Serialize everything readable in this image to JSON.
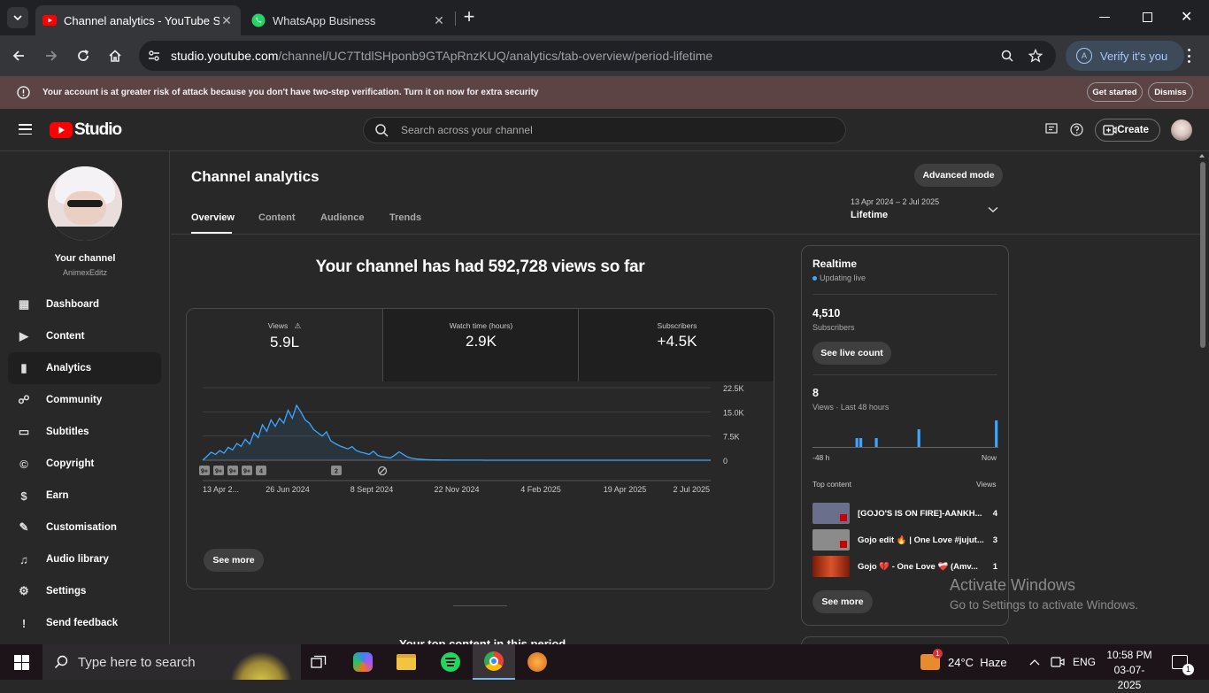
{
  "browser": {
    "tabs": [
      {
        "title": "Channel analytics - YouTube Studio",
        "active": true
      },
      {
        "title": "WhatsApp Business",
        "active": false
      }
    ],
    "url_host": "studio.youtube.com",
    "url_path": "/channel/UC7TtdlSHponb9GTApRnzKUQ/analytics/tab-overview/period-lifetime",
    "verify_label": "Verify it's you",
    "verify_avatar": "A"
  },
  "warning": {
    "text": "Your account is at greater risk of attack because you don't have two-step verification. Turn it on now for extra security",
    "get_started": "Get started",
    "dismiss": "Dismiss"
  },
  "header": {
    "logo": "Studio",
    "search_placeholder": "Search across your channel",
    "create_label": "Create"
  },
  "sidebar": {
    "channel_label": "Your channel",
    "channel_name": "AnimexEditz",
    "items": [
      {
        "label": "Dashboard",
        "icon": "dashboard-icon"
      },
      {
        "label": "Content",
        "icon": "content-icon"
      },
      {
        "label": "Analytics",
        "icon": "analytics-icon",
        "active": true
      },
      {
        "label": "Community",
        "icon": "community-icon"
      },
      {
        "label": "Subtitles",
        "icon": "subtitles-icon"
      },
      {
        "label": "Copyright",
        "icon": "copyright-icon"
      },
      {
        "label": "Earn",
        "icon": "earn-icon"
      },
      {
        "label": "Customisation",
        "icon": "customisation-icon"
      },
      {
        "label": "Audio library",
        "icon": "audio-library-icon"
      },
      {
        "label": "Settings",
        "icon": "settings-icon"
      },
      {
        "label": "Send feedback",
        "icon": "feedback-icon"
      }
    ]
  },
  "main": {
    "title": "Channel analytics",
    "advanced_mode": "Advanced mode",
    "tabs": [
      "Overview",
      "Content",
      "Audience",
      "Trends"
    ],
    "period_range": "13 Apr 2024 – 2 Jul 2025",
    "period_label": "Lifetime",
    "headline": "Your channel has had 592,728 views so far",
    "metrics": [
      {
        "label": "Views",
        "value": "5.9L",
        "warning": true
      },
      {
        "label": "Watch time (hours)",
        "value": "2.9K"
      },
      {
        "label": "Subscribers",
        "value": "+4.5K"
      }
    ],
    "see_more": "See more",
    "next_section": "Your top content in this period"
  },
  "chart_data": {
    "type": "line",
    "x_tick_labels": [
      "13 Apr 2...",
      "26 Jun 2024",
      "8 Sept 2024",
      "22 Nov 2024",
      "4 Feb 2025",
      "19 Apr 2025",
      "2 Jul 2025"
    ],
    "y_tick_labels": [
      "22.5K",
      "15.0K",
      "7.5K",
      "0"
    ],
    "ylim": [
      0,
      22500
    ],
    "series": [
      {
        "values": [
          0,
          1200,
          2500,
          1800,
          3000,
          2200,
          4000,
          3200,
          5200,
          4300,
          6500,
          5000,
          8500,
          7000,
          11000,
          9000,
          12500,
          10500,
          13000,
          11500,
          15500,
          13000,
          17000,
          15000,
          12500,
          11500,
          9500,
          8500,
          7500,
          8800,
          6000,
          5200,
          4500,
          4000,
          3500,
          4200,
          3000,
          2500,
          2200,
          1800,
          2800,
          1500,
          1100,
          900,
          700,
          1600,
          2600,
          1800,
          1000,
          600,
          400,
          300,
          200,
          150,
          100,
          80,
          60,
          50,
          40,
          30,
          25,
          20,
          20,
          15,
          15,
          15,
          10,
          10,
          10,
          10,
          10,
          10,
          10,
          10,
          10,
          10,
          10,
          10,
          10,
          10,
          10,
          10,
          10,
          10,
          10,
          10,
          10,
          10,
          10,
          10,
          10,
          10,
          10,
          10,
          10,
          10,
          10,
          10,
          10,
          10,
          10,
          10,
          10,
          10,
          10,
          10,
          10,
          10,
          10,
          10,
          10,
          10,
          10,
          10,
          10,
          10,
          10,
          10,
          10,
          10
        ]
      }
    ],
    "markers": [
      "9+",
      "9+",
      "9+",
      "9+",
      "4",
      "2"
    ],
    "grid": true,
    "color": "#3ea6ff"
  },
  "realtime": {
    "title": "Realtime",
    "status": "Updating live",
    "subs_value": "4,510",
    "subs_label": "Subscribers",
    "live_count_btn": "See live count",
    "views_value": "8",
    "views_label": "Views · Last 48 hours",
    "axis_left": "-48 h",
    "axis_right": "Now",
    "bars": [
      0,
      0,
      0,
      0,
      0,
      0,
      0,
      0,
      0,
      0,
      0,
      1,
      1,
      0,
      0,
      0,
      1,
      0,
      0,
      0,
      0,
      0,
      0,
      0,
      0,
      0,
      0,
      2,
      0,
      0,
      0,
      0,
      0,
      0,
      0,
      0,
      0,
      0,
      0,
      0,
      0,
      0,
      0,
      0,
      0,
      0,
      0,
      3
    ],
    "top_content_label": "Top content",
    "top_views_label": "Views",
    "items": [
      {
        "title": "[GOJO'S IS ON FIRE]-AANKH...",
        "views": "4",
        "color": "#6a6f8c"
      },
      {
        "title": "Gojo edit 🔥 | One Love #jujut...",
        "views": "3",
        "color": "#8b8b8b"
      },
      {
        "title": "Gojo 💔 - One Love ❤️‍🩹 (Amv...",
        "views": "1",
        "color": "#a8321e"
      }
    ],
    "see_more": "See more"
  },
  "watermark": {
    "line1": "Activate Windows",
    "line2": "Go to Settings to activate Windows."
  },
  "taskbar": {
    "search_placeholder": "Type here to search",
    "weather": "24°C  Haze",
    "weather_badge": "1",
    "language": "ENG",
    "time": "10:58 PM",
    "date": "03-07-2025",
    "notification_badge": "1"
  }
}
